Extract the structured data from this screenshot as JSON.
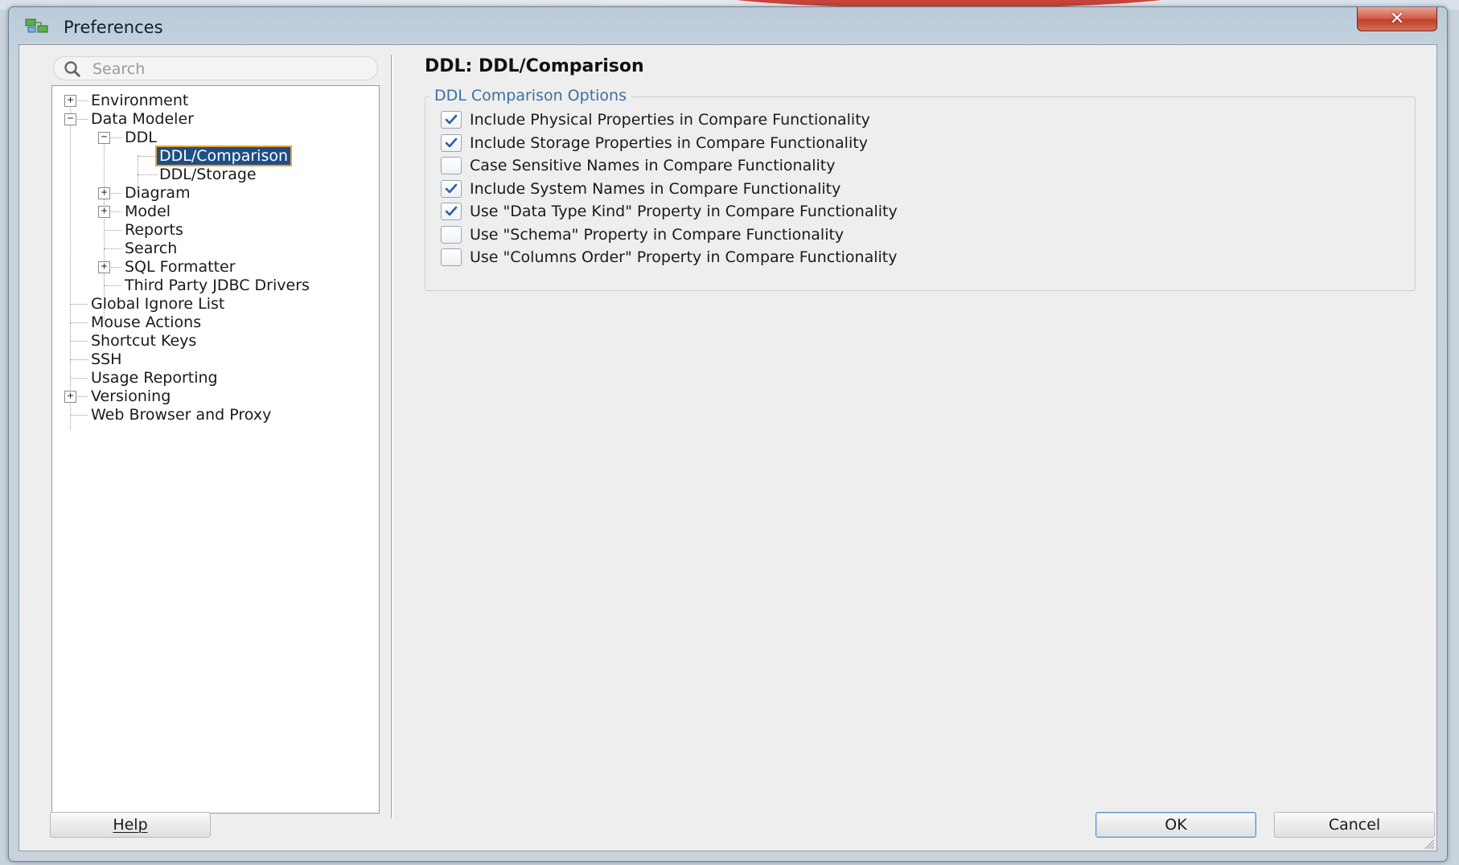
{
  "window": {
    "title": "Preferences",
    "close_label": "✕"
  },
  "search": {
    "placeholder": "Search"
  },
  "tree": {
    "items": [
      {
        "label": "Environment"
      },
      {
        "label": "Data Modeler"
      },
      {
        "label": "DDL"
      },
      {
        "label": "DDL/Comparison"
      },
      {
        "label": "DDL/Storage"
      },
      {
        "label": "Diagram"
      },
      {
        "label": "Model"
      },
      {
        "label": "Reports"
      },
      {
        "label": "Search"
      },
      {
        "label": "SQL Formatter"
      },
      {
        "label": "Third Party JDBC Drivers"
      },
      {
        "label": "Global Ignore List"
      },
      {
        "label": "Mouse Actions"
      },
      {
        "label": "Shortcut Keys"
      },
      {
        "label": "SSH"
      },
      {
        "label": "Usage Reporting"
      },
      {
        "label": "Versioning"
      },
      {
        "label": "Web Browser and Proxy"
      }
    ]
  },
  "page": {
    "title": "DDL: DDL/Comparison",
    "group_title": "DDL Comparison Options",
    "options": [
      {
        "label": "Include Physical Properties in Compare Functionality",
        "checked": true
      },
      {
        "label": "Include Storage Properties in Compare Functionality",
        "checked": true
      },
      {
        "label": "Case Sensitive Names in Compare Functionality",
        "checked": false
      },
      {
        "label": "Include System Names in Compare Functionality",
        "checked": true
      },
      {
        "label": "Use \"Data Type Kind\" Property in Compare Functionality",
        "checked": true
      },
      {
        "label": "Use \"Schema\" Property in Compare Functionality",
        "checked": false
      },
      {
        "label": "Use \"Columns Order\" Property in Compare Functionality",
        "checked": false
      }
    ]
  },
  "buttons": {
    "help": "Help",
    "ok": "OK",
    "cancel": "Cancel"
  },
  "colors": {
    "selection": "#1f4e86",
    "group_title": "#3d6fa0",
    "checkmark": "#2b5fa8"
  }
}
